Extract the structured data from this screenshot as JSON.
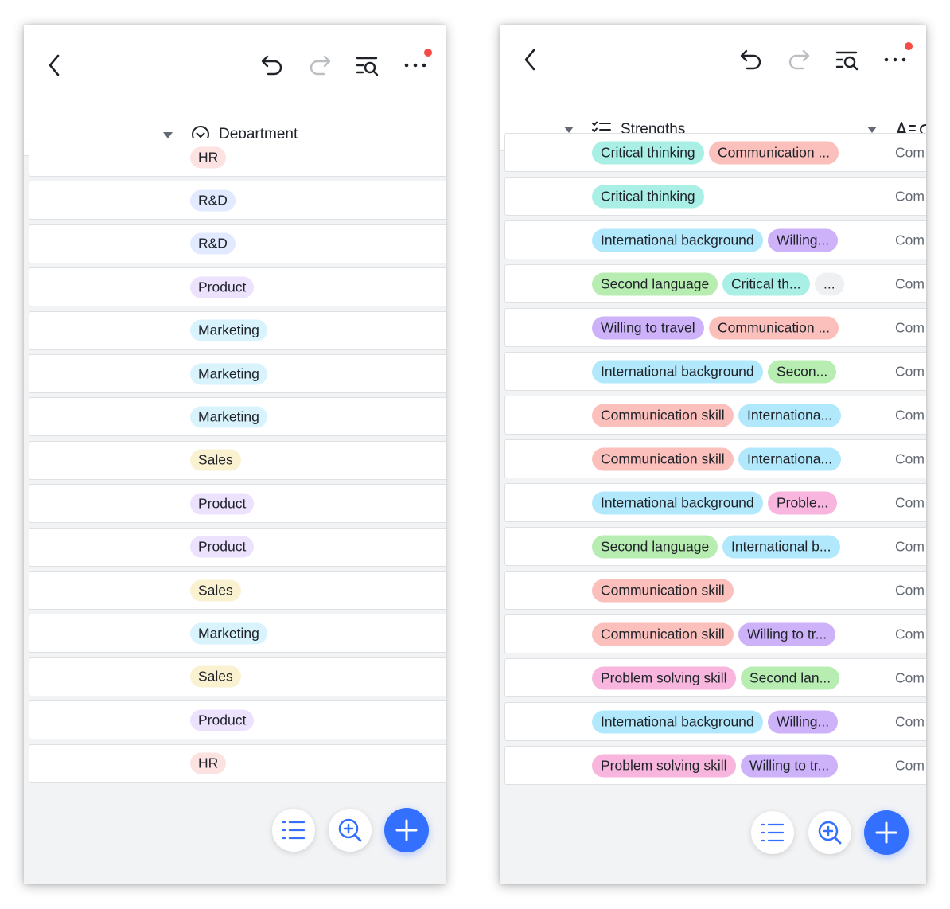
{
  "left": {
    "column_header": "Department",
    "rows": [
      {
        "label": "HR",
        "color": "#fde2e2"
      },
      {
        "label": "R&D",
        "color": "#e1eaff"
      },
      {
        "label": "R&D",
        "color": "#e1eaff"
      },
      {
        "label": "Product",
        "color": "#ece2fe"
      },
      {
        "label": "Marketing",
        "color": "#d9f3fd"
      },
      {
        "label": "Marketing",
        "color": "#d9f3fd"
      },
      {
        "label": "Marketing",
        "color": "#d9f3fd"
      },
      {
        "label": "Sales",
        "color": "#faf1d1"
      },
      {
        "label": "Product",
        "color": "#ece2fe"
      },
      {
        "label": "Product",
        "color": "#ece2fe"
      },
      {
        "label": "Sales",
        "color": "#faf1d1"
      },
      {
        "label": "Marketing",
        "color": "#d9f3fd"
      },
      {
        "label": "Sales",
        "color": "#faf1d1"
      },
      {
        "label": "Product",
        "color": "#ece2fe"
      },
      {
        "label": "HR",
        "color": "#fde2e2"
      }
    ]
  },
  "right": {
    "column_header": "Strengths",
    "next_column_cell": "Com",
    "rows": [
      {
        "tags": [
          {
            "label": "Critical thinking",
            "color": "#a9efe6"
          },
          {
            "label": "Communication ...",
            "color": "#fbbfbc"
          }
        ]
      },
      {
        "tags": [
          {
            "label": "Critical thinking",
            "color": "#a9efe6"
          }
        ]
      },
      {
        "tags": [
          {
            "label": "International background",
            "color": "#b1e8fc"
          },
          {
            "label": "Willing...",
            "color": "#cdb2fa"
          }
        ]
      },
      {
        "tags": [
          {
            "label": "Second language",
            "color": "#b7edb1"
          },
          {
            "label": "Critical th...",
            "color": "#a9efe6"
          },
          {
            "label": "...",
            "color": "#eff0f1"
          }
        ]
      },
      {
        "tags": [
          {
            "label": "Willing to travel",
            "color": "#cdb2fa"
          },
          {
            "label": "Communication ...",
            "color": "#fbbfbc"
          }
        ]
      },
      {
        "tags": [
          {
            "label": "International background",
            "color": "#b1e8fc"
          },
          {
            "label": "Secon...",
            "color": "#b7edb1"
          }
        ]
      },
      {
        "tags": [
          {
            "label": "Communication skill",
            "color": "#fbbfbc"
          },
          {
            "label": "Internationa...",
            "color": "#b1e8fc"
          }
        ]
      },
      {
        "tags": [
          {
            "label": "Communication skill",
            "color": "#fbbfbc"
          },
          {
            "label": "Internationa...",
            "color": "#b1e8fc"
          }
        ]
      },
      {
        "tags": [
          {
            "label": "International background",
            "color": "#b1e8fc"
          },
          {
            "label": "Proble...",
            "color": "#f8b5dd"
          }
        ]
      },
      {
        "tags": [
          {
            "label": "Second language",
            "color": "#b7edb1"
          },
          {
            "label": "International b...",
            "color": "#b1e8fc"
          }
        ]
      },
      {
        "tags": [
          {
            "label": "Communication skill",
            "color": "#fbbfbc"
          }
        ]
      },
      {
        "tags": [
          {
            "label": "Communication skill",
            "color": "#fbbfbc"
          },
          {
            "label": "Willing to tr...",
            "color": "#cdb2fa"
          }
        ]
      },
      {
        "tags": [
          {
            "label": "Problem solving skill",
            "color": "#f8b5dd"
          },
          {
            "label": "Second lan...",
            "color": "#b7edb1"
          }
        ]
      },
      {
        "tags": [
          {
            "label": "International background",
            "color": "#b1e8fc"
          },
          {
            "label": "Willing...",
            "color": "#cdb2fa"
          }
        ]
      },
      {
        "tags": [
          {
            "label": "Problem solving skill",
            "color": "#f8b5dd"
          },
          {
            "label": "Willing to tr...",
            "color": "#cdb2fa"
          }
        ]
      }
    ]
  },
  "colors": {
    "accent": "#3370ff",
    "notification": "#f54a45",
    "icon": "#1f2329",
    "icon_disabled": "#bbbfc4"
  },
  "icons": [
    "back-icon",
    "undo-icon",
    "redo-icon",
    "search-view-icon",
    "more-icon",
    "dropdown-caret-icon",
    "single-select-field-icon",
    "multi-select-field-icon",
    "text-field-icon",
    "list-icon",
    "zoom-in-icon",
    "add-icon"
  ]
}
